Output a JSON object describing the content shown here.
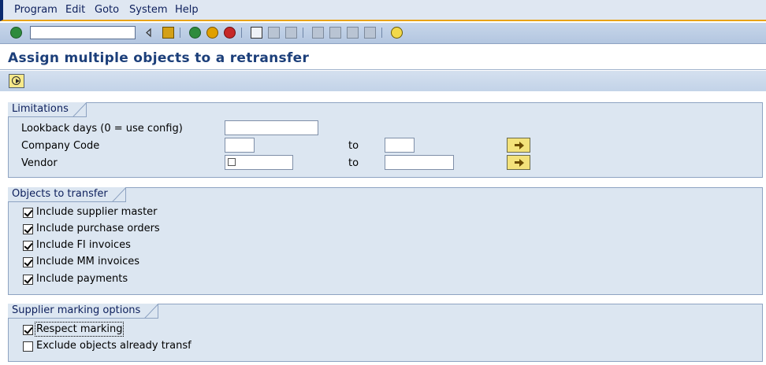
{
  "menu": {
    "items": [
      "Program",
      "Edit",
      "Goto",
      "System",
      "Help"
    ]
  },
  "toolbar": {
    "command_field_value": "",
    "icons": [
      "enter-icon",
      "back-arrow-icon",
      "save-icon",
      "back-icon",
      "exit-icon",
      "cancel-icon",
      "print-icon",
      "find-icon",
      "find-next-icon",
      "first-page-icon",
      "previous-page-icon",
      "next-page-icon",
      "last-page-icon",
      "help-icon"
    ]
  },
  "page": {
    "title": "Assign multiple objects to a retransfer"
  },
  "limitations": {
    "title": "Limitations",
    "lookback_label": "Lookback days (0 = use config)",
    "lookback_value": "",
    "company_code_label": "Company Code",
    "company_code_from": "",
    "company_code_to": "",
    "vendor_label": "Vendor",
    "vendor_from": "",
    "vendor_to": "",
    "to_label": "to"
  },
  "objects": {
    "title": "Objects to transfer",
    "options": [
      {
        "label": "Include supplier master",
        "checked": true
      },
      {
        "label": "Include purchase orders",
        "checked": true
      },
      {
        "label": "Include FI invoices",
        "checked": true
      },
      {
        "label": "Include MM invoices",
        "checked": true
      },
      {
        "label": "Include payments",
        "checked": true
      }
    ]
  },
  "marking": {
    "title": "Supplier marking options",
    "options": [
      {
        "label": "Respect marking",
        "checked": true
      },
      {
        "label": "Exclude objects already transf",
        "checked": false
      }
    ]
  },
  "colors": {
    "accent": "#e8a317",
    "title": "#1c3f7a",
    "group_bg": "#dce6f1"
  }
}
